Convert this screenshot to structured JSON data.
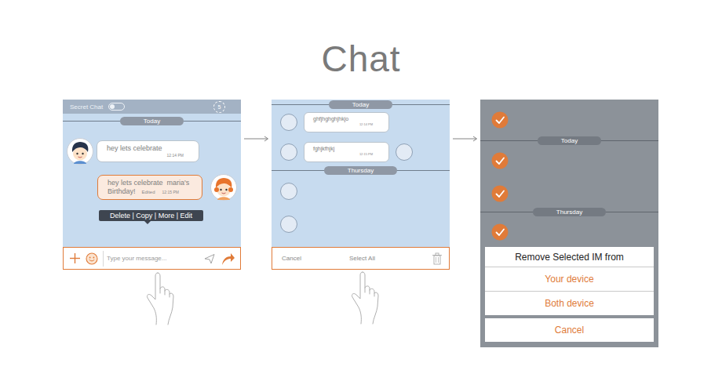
{
  "title": "Chat",
  "chat_screen": {
    "header": {
      "label": "Secret Chat",
      "secret_on": false,
      "badge": "5"
    },
    "date": "Today",
    "messages": [
      {
        "text": "hey lets celebrate",
        "time": "12:14 PM",
        "side": "left",
        "selected": false
      },
      {
        "text": "hey lets celebrate  maria's Birthday!",
        "edited": "Edited",
        "time": "12:15 PM",
        "side": "right",
        "selected": true
      }
    ],
    "context_menu": "Delete | Copy | More | Edit",
    "composer": {
      "placeholder": "Type your message..."
    }
  },
  "select_screen": {
    "items": [
      {
        "kind": "separator",
        "label": "Today"
      },
      {
        "kind": "message",
        "text": "ghfjhghghjhkjo",
        "time": "12:14 PM",
        "checked": false
      },
      {
        "kind": "message",
        "text": "fghjkfhjkj",
        "time": "12:15 PM",
        "checked": false,
        "trailing_checked": false
      },
      {
        "kind": "separator",
        "label": "Thursday"
      },
      {
        "kind": "empty",
        "checked": false
      },
      {
        "kind": "empty",
        "checked": false
      }
    ],
    "toolbar": {
      "cancel": "Cancel",
      "select_all": "Select All"
    }
  },
  "remove_screen": {
    "items": [
      {
        "kind": "row",
        "checked": true
      },
      {
        "kind": "separator",
        "label": "Today"
      },
      {
        "kind": "row",
        "checked": true
      },
      {
        "kind": "row",
        "checked": true
      },
      {
        "kind": "separator",
        "label": "Thursday"
      },
      {
        "kind": "row",
        "checked": true
      }
    ],
    "sheet": {
      "title": "Remove Selected IM from",
      "options": [
        "Your device",
        "Both device"
      ],
      "cancel": "Cancel"
    }
  }
}
